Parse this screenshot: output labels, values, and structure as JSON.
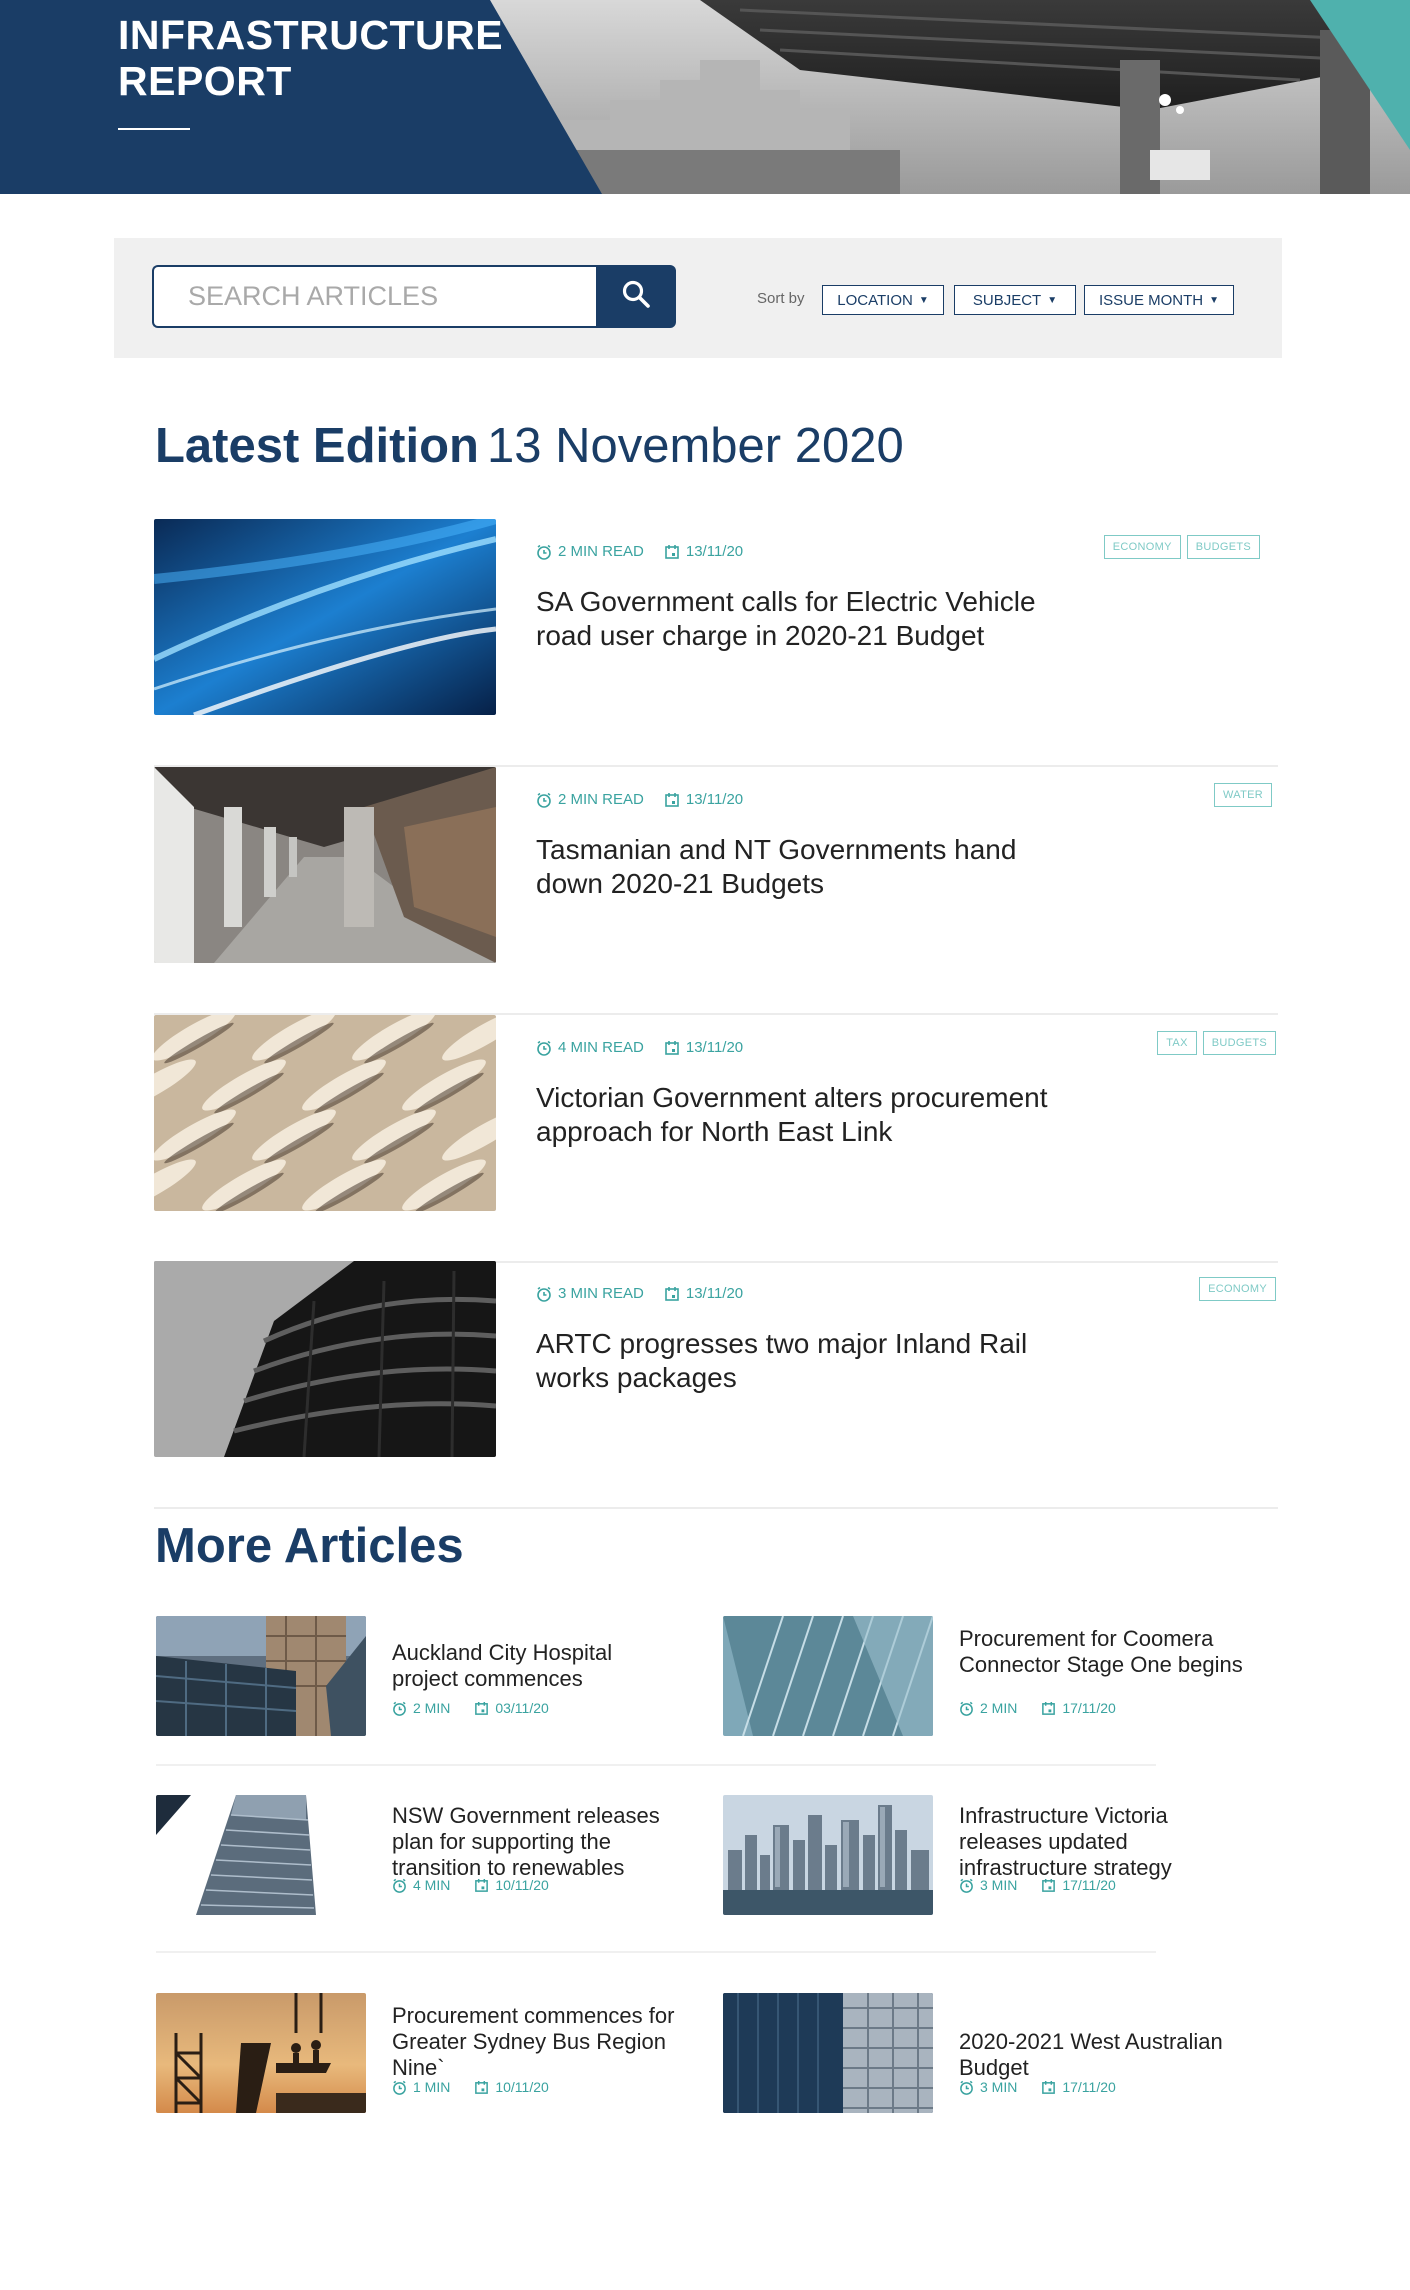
{
  "header": {
    "title": "INFRASTRUCTURE\nREPORT"
  },
  "search": {
    "placeholder": "SEARCH ARTICLES",
    "button_icon": "search-icon"
  },
  "sort": {
    "label": "Sort by",
    "options": [
      {
        "label": "LOCATION"
      },
      {
        "label": "SUBJECT"
      },
      {
        "label": "ISSUE MONTH"
      }
    ]
  },
  "latest": {
    "heading": "Latest Edition",
    "date": "13 November 2020",
    "articles": [
      {
        "read_time": "2 MIN READ",
        "date": "13/11/20",
        "title": "SA Government calls for Electric Vehicle road user charge in 2020-21 Budget",
        "tags": [
          "ECONOMY",
          "BUDGETS"
        ]
      },
      {
        "read_time": "2 MIN READ",
        "date": "13/11/20",
        "title": "Tasmanian and NT Governments hand down 2020-21 Budgets",
        "tags": [
          "WATER"
        ]
      },
      {
        "read_time": "4 MIN READ",
        "date": "13/11/20",
        "title": "Victorian Government alters procurement approach for North East Link",
        "tags": [
          "TAX",
          "BUDGETS"
        ]
      },
      {
        "read_time": "3 MIN READ",
        "date": "13/11/20",
        "title": "ARTC progresses two major Inland Rail works packages",
        "tags": [
          "ECONOMY"
        ]
      }
    ]
  },
  "more": {
    "heading": "More Articles",
    "articles": [
      {
        "title": "Auckland City Hospital project commences",
        "read_time": "2 MIN",
        "date": "03/11/20"
      },
      {
        "title": "Procurement for Coomera Connector Stage One begins",
        "read_time": "2 MIN",
        "date": "17/11/20"
      },
      {
        "title": "NSW Government releases plan for supporting the transition to renewables",
        "read_time": "4 MIN",
        "date": "10/11/20"
      },
      {
        "title": "Infrastructure Victoria releases updated infrastructure strategy",
        "read_time": "3 MIN",
        "date": "17/11/20"
      },
      {
        "title": "Procurement commences for Greater Sydney Bus Region Nine`",
        "read_time": "1 MIN",
        "date": "10/11/20"
      },
      {
        "title": "2020-2021 West Australian Budget",
        "read_time": "3 MIN",
        "date": "17/11/20"
      }
    ]
  },
  "colors": {
    "brand_navy": "#1a3d66",
    "accent_teal": "#3aa3a0",
    "tag_teal": "#7fcac6"
  }
}
